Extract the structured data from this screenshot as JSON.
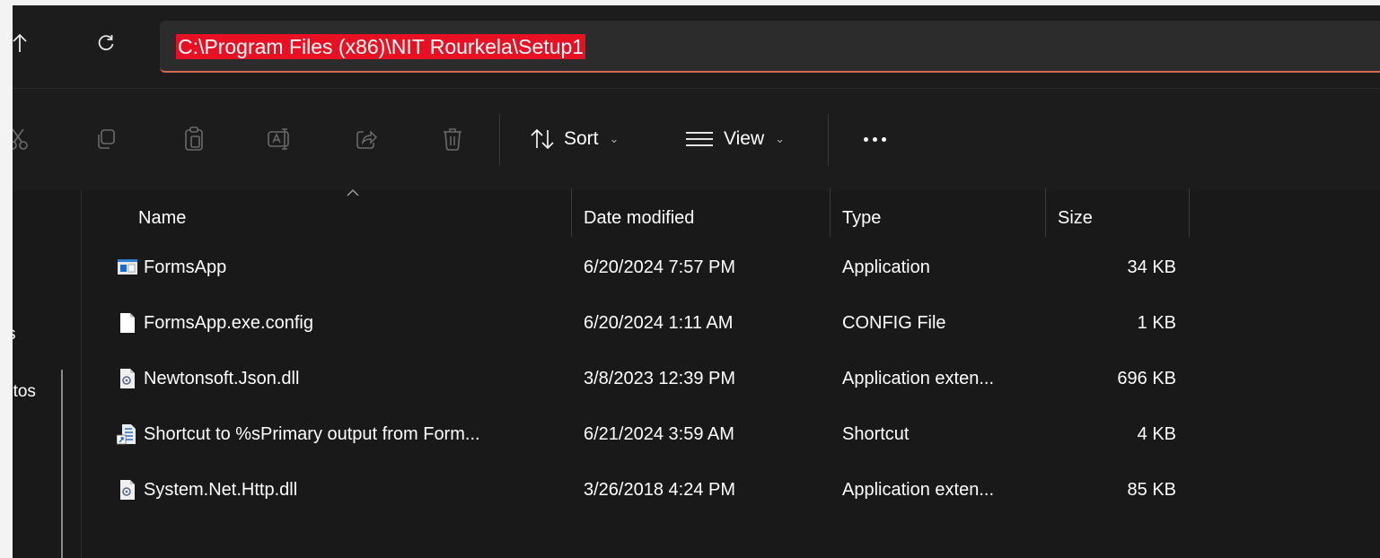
{
  "address_bar": {
    "path": "C:\\Program Files (x86)\\NIT Rourkela\\Setup1"
  },
  "nav_icons": [
    "up-arrow-icon",
    "refresh-icon"
  ],
  "command_bar": {
    "icons": [
      "cut-icon",
      "copy-icon",
      "paste-icon",
      "rename-icon",
      "share-icon",
      "delete-icon"
    ],
    "sort_label": "Sort",
    "view_label": "View",
    "more_label": "..."
  },
  "nav_pane": {
    "items": [
      "s",
      "otos"
    ]
  },
  "columns": {
    "name": "Name",
    "date_modified": "Date modified",
    "type": "Type",
    "size": "Size"
  },
  "files": [
    {
      "name": "FormsApp",
      "date": "6/20/2024 7:57 PM",
      "type": "Application",
      "size": "34 KB",
      "icon": "application-icon"
    },
    {
      "name": "FormsApp.exe.config",
      "date": "6/20/2024 1:11 AM",
      "type": "CONFIG File",
      "size": "1 KB",
      "icon": "file-icon"
    },
    {
      "name": "Newtonsoft.Json.dll",
      "date": "3/8/2023 12:39 PM",
      "type": "Application exten...",
      "size": "696 KB",
      "icon": "dll-icon"
    },
    {
      "name": "Shortcut to %sPrimary output from Form...",
      "date": "6/21/2024 3:59 AM",
      "type": "Shortcut",
      "size": "4 KB",
      "icon": "shortcut-icon"
    },
    {
      "name": "System.Net.Http.dll",
      "date": "3/26/2018 4:24 PM",
      "type": "Application exten...",
      "size": "85 KB",
      "icon": "dll-icon"
    }
  ],
  "colors": {
    "background": "#191919",
    "selection_highlight": "#e81123",
    "address_underline": "#d26a57"
  }
}
